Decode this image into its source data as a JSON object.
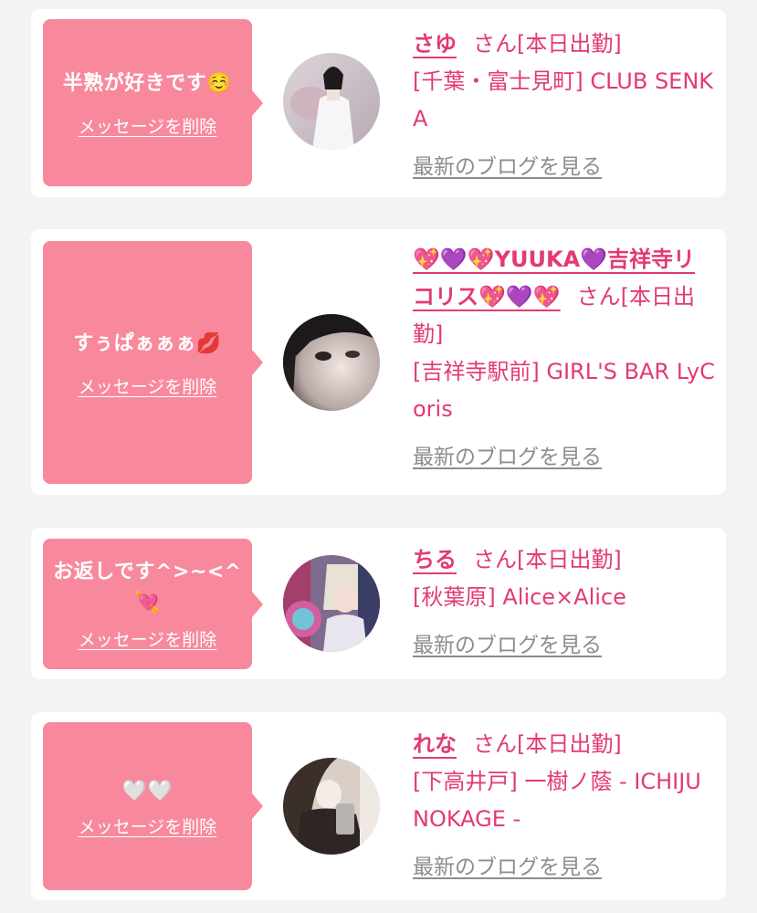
{
  "items": [
    {
      "message": "半熟が好きです☺️",
      "delete_label": "メッセージを削除",
      "name": "さゆ",
      "suffix": "さん[本日出勤]",
      "shop": "[千葉・富士見町] CLUB SENKA",
      "blog_label": "最新のブログを見る",
      "avatar_icon": "profile-photo"
    },
    {
      "message": "すぅぱぁぁぁ💋",
      "delete_label": "メッセージを削除",
      "name": "💖💜💖YUUKA💜吉祥寺リコリス💖💜💖",
      "suffix": "さん[本日出勤]",
      "shop": "[吉祥寺駅前] GIRL'S BAR LyCoris",
      "blog_label": "最新のブログを見る",
      "avatar_icon": "profile-photo"
    },
    {
      "message": "お返しです^>~<^💘",
      "delete_label": "メッセージを削除",
      "name": "ちる",
      "suffix": "さん[本日出勤]",
      "shop": "[秋葉原] Alice×Alice",
      "blog_label": "最新のブログを見る",
      "avatar_icon": "profile-photo"
    },
    {
      "message": "🤍🤍",
      "delete_label": "メッセージを削除",
      "name": "れな",
      "suffix": "さん[本日出勤]",
      "shop": "[下高井戸] 一樹ノ蔭 - ICHIJUNOKAGE -",
      "blog_label": "最新のブログを見る",
      "avatar_icon": "profile-photo"
    }
  ],
  "colors": {
    "bubble": "#f8899c",
    "name": "#e33a71",
    "blog_link": "#8d8d8d",
    "page_bg": "#f3f3f4"
  }
}
